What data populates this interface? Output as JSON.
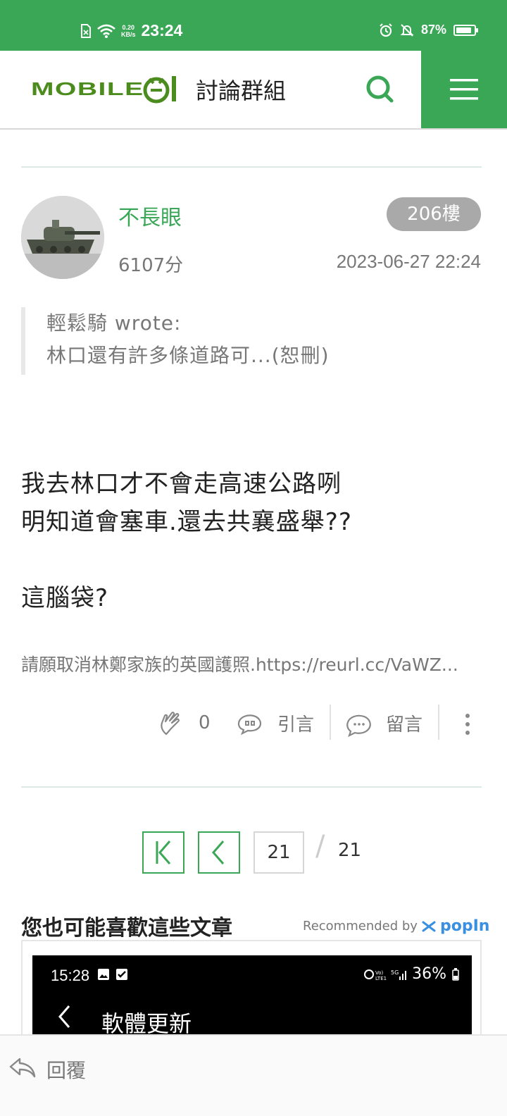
{
  "status_bar": {
    "time": "23:24",
    "speed_top": "0.20",
    "speed_bottom": "KB/s",
    "battery": "87%",
    "battery_level": 0.87
  },
  "header": {
    "logo_text": "MOBILE",
    "title": "討論群組"
  },
  "post": {
    "username": "不長眼",
    "score": "6107分",
    "floor": "206樓",
    "datetime": "2023-06-27 22:24",
    "quote": {
      "author_line": "輕鬆騎 wrote:",
      "text": "林口還有許多條道路可...(恕刪)"
    },
    "body": [
      "我去林口才不會走高速公路咧",
      "明知道會塞車.還去共襄盛舉??",
      "",
      "這腦袋?"
    ],
    "signature": "請願取消林鄭家族的英國護照.https://reurl.cc/VaWZ...",
    "like_count": "0",
    "quote_label": "引言",
    "comment_label": "留言"
  },
  "pager": {
    "current": "21",
    "separator": "/",
    "total": "21"
  },
  "recommend": {
    "title": "您也可能喜歡這些文章",
    "by_label": "Recommended by",
    "brand": "popIn",
    "card": {
      "time": "15:28",
      "status": "36%",
      "heading": "軟體更新"
    }
  },
  "reply_bar": {
    "label": "回覆"
  },
  "colors": {
    "accent": "#3aa757",
    "logo": "#4c8c1e",
    "badge": "#a9a9a9"
  }
}
